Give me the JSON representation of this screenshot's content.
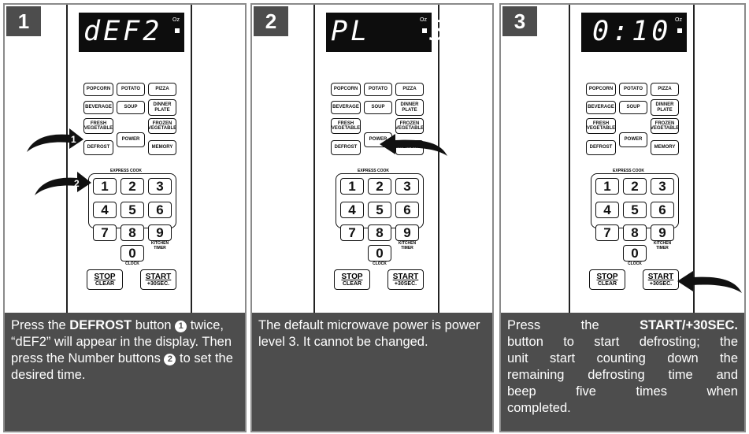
{
  "steps": [
    {
      "number": "1",
      "display": "dEF2",
      "caption_parts": [
        "Press the ",
        "DEFROST",
        " button ",
        "1",
        " twice, “dEF2” will appear in the display.  Then  press  the Number buttons ",
        "2",
        " to set the desired time."
      ],
      "arrow_labels": [
        "1",
        "2"
      ]
    },
    {
      "number": "2",
      "display": "PL   3",
      "caption": "The default microwave power is power level 3. It cannot be changed."
    },
    {
      "number": "3",
      "display": "0:10",
      "caption_line1_a": "Press   the   ",
      "caption_line1_b": "START/+30SEC.",
      "caption_lines": [
        "button to start defrosting; the",
        "unit start counting down the",
        "remaining defrosting time and",
        "beep   five   times   when"
      ],
      "caption_last": "completed."
    }
  ],
  "microwave": {
    "display_unit": "Oz",
    "buttons": {
      "popcorn": "POPCORN",
      "potato": "POTATO",
      "pizza": "PIZZA",
      "beverage": "BEVERAGE",
      "soup": "SOUP",
      "dinner_plate": "DINNER PLATE",
      "fresh_vegetable": "FRESH VEGETABLE",
      "frozen_vegetable": "FROZEN VEGETABLE",
      "power": "POWER",
      "defrost": "DEFROST",
      "memory": "MEMORY"
    },
    "express_cook_label": "EXPRESS COOK",
    "numbers": [
      "1",
      "2",
      "3",
      "4",
      "5",
      "6",
      "7",
      "8",
      "9",
      "0"
    ],
    "kitchen_timer_label": "KITCHEN TIMER",
    "clock_label": "CLOCK",
    "stop": {
      "main": "STOP",
      "sub": "CLEAR"
    },
    "start": {
      "main": "START",
      "sub": "+30SEC."
    }
  }
}
